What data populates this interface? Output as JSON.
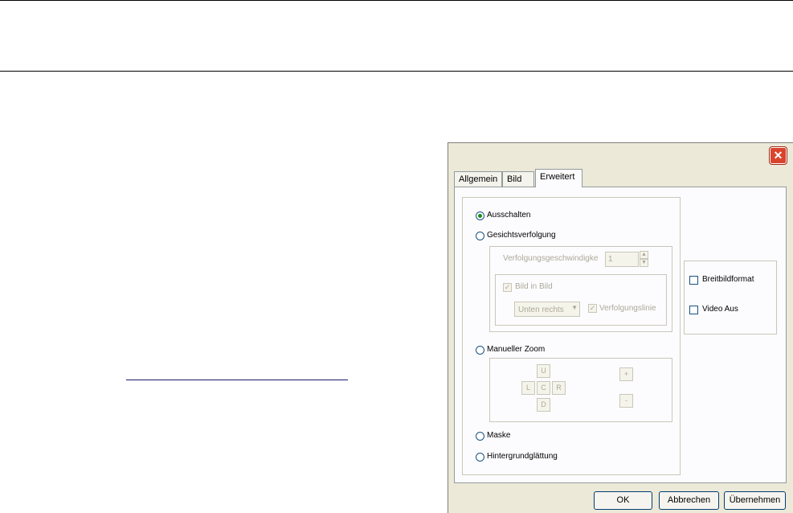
{
  "dialog": {
    "close_glyph": "✕",
    "tabs": [
      {
        "label": "Allgemein"
      },
      {
        "label": "Bild"
      },
      {
        "label": "Erweitert"
      }
    ],
    "options": {
      "ausschalten": "Ausschalten",
      "gesichtsverfolgung": "Gesichtsverfolgung",
      "manueller_zoom": "Manueller Zoom",
      "maske": "Maske",
      "hintergrund": "Hintergrundglättung"
    },
    "selected_option": "Ausschalten",
    "tracking": {
      "speed_label": "Verfolgungsgeschwindigke",
      "speed_value": "1",
      "pip_label": "Bild in Bild",
      "position_value": "Unten rechts",
      "line_label": "Verfolgungslinie"
    },
    "zoom": {
      "up": "U",
      "left": "L",
      "center": "C",
      "right": "R",
      "down": "D",
      "plus": "+",
      "minus": "-"
    },
    "display": {
      "widescreen_label": "Breitbildformat",
      "video_off_label": "Video Aus"
    },
    "buttons": {
      "ok": "OK",
      "cancel": "Abbrechen",
      "apply": "Übernehmen"
    }
  }
}
